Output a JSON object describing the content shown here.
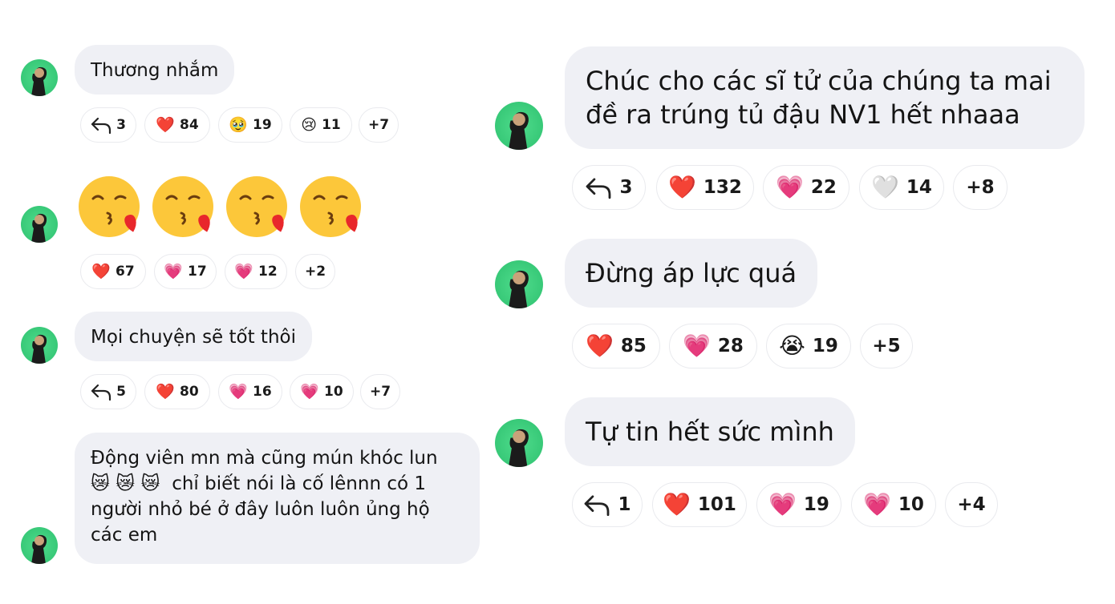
{
  "left": [
    {
      "text": [
        "Thương nhắm"
      ],
      "reactions": [
        {
          "icon": "reply-icon",
          "count": "3"
        },
        {
          "emoji": "❤️",
          "icon": "red-heart-icon",
          "count": "84"
        },
        {
          "emoji": "🥹",
          "icon": "holding-back-tears-icon",
          "count": "19"
        },
        {
          "emoji": "😢",
          "icon": "crying-face-icon",
          "count": "11"
        },
        {
          "count": "+7"
        }
      ]
    },
    {
      "big_emojis": [
        "kissing-face-heart-icon",
        "kissing-face-heart-icon",
        "kissing-face-heart-icon",
        "kissing-face-heart-icon"
      ],
      "reactions": [
        {
          "emoji": "❤️",
          "icon": "red-heart-icon",
          "count": "67"
        },
        {
          "emoji": "💗",
          "icon": "pink-heart-icon",
          "count": "17"
        },
        {
          "emoji": "💗",
          "icon": "growing-heart-icon",
          "count": "12"
        },
        {
          "count": "+2"
        }
      ]
    },
    {
      "text": [
        "Mọi chuyện sẽ tốt thôi"
      ],
      "reactions": [
        {
          "icon": "reply-icon",
          "count": "5"
        },
        {
          "emoji": "❤️",
          "icon": "red-heart-icon",
          "count": "80"
        },
        {
          "emoji": "💗",
          "icon": "growing-heart-icon",
          "count": "16"
        },
        {
          "emoji": "💗",
          "icon": "pink-heart-icon",
          "count": "10"
        },
        {
          "count": "+7"
        }
      ]
    },
    {
      "text": [
        "Động viên mn mà cũng mún khóc lun",
        "😿😿😿 chỉ biết nói là cố lênnn có 1",
        "người nhỏ bé ở đây luôn luôn ủng hộ",
        "các em"
      ],
      "emoji_line_prefix": "😿 😿 😿",
      "emoji_line_rest": "chỉ biết nói là cố lênnn có 1"
    }
  ],
  "right": [
    {
      "text": [
        "Chúc cho các sĩ tử của chúng ta mai",
        "đề ra trúng tủ đậu NV1 hết nhaaa"
      ],
      "reactions": [
        {
          "icon": "reply-icon",
          "count": "3"
        },
        {
          "emoji": "❤️",
          "icon": "red-heart-icon",
          "count": "132"
        },
        {
          "emoji": "💗",
          "icon": "pink-heart-icon",
          "count": "22"
        },
        {
          "emoji": "🤍",
          "icon": "white-heart-icon",
          "count": "14"
        },
        {
          "count": "+8"
        }
      ]
    },
    {
      "text": [
        "Đừng áp lực quá"
      ],
      "reactions": [
        {
          "emoji": "❤️",
          "icon": "red-heart-icon",
          "count": "85"
        },
        {
          "emoji": "💗",
          "icon": "growing-heart-icon",
          "count": "28"
        },
        {
          "emoji": "😭",
          "icon": "loudly-crying-face-icon",
          "count": "19"
        },
        {
          "count": "+5"
        }
      ]
    },
    {
      "text": [
        "Tự tin hết sức mình"
      ],
      "reactions": [
        {
          "icon": "reply-icon",
          "count": "1"
        },
        {
          "emoji": "❤️",
          "icon": "red-heart-icon",
          "count": "101"
        },
        {
          "emoji": "💗",
          "icon": "growing-heart-icon",
          "count": "19"
        },
        {
          "emoji": "💗",
          "icon": "pink-heart-icon",
          "count": "10"
        },
        {
          "count": "+4"
        }
      ]
    }
  ]
}
